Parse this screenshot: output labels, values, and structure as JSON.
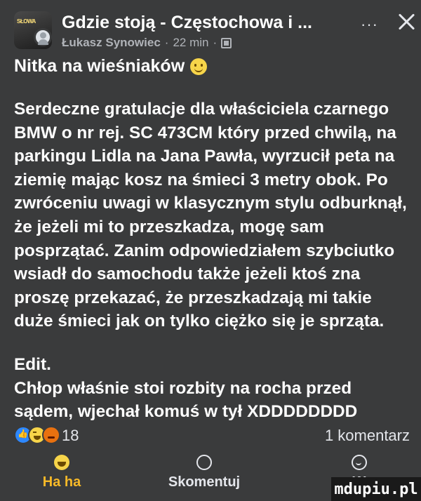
{
  "header": {
    "avatar_text": "SŁOWA",
    "group_name": "Gdzie stoją - Częstochowa i ...",
    "author": "Łukasz Synowiec",
    "time": "22 min",
    "separator": "·",
    "more_label": "···",
    "icons": {
      "more": "more-horizontal-icon",
      "close": "close-icon",
      "audience": "audience-icon"
    }
  },
  "post": {
    "title": "Nitka na wieśniaków",
    "title_emoji": "smile-icon",
    "paragraphs": [
      "Serdeczne gratulacje dla właściciela czarnego BMW o nr rej. SC 473CM który przed chwilą, na parkingu Lidla na Jana Pawła, wyrzucił peta na ziemię mając kosz na śmieci 3 metry obok. Po zwróceniu uwagi w klasycznym stylu odburknął, że jeżeli mi to przeszkadza, mogę sam posprzątać. Zanim odpowiedziałem szybciutko wsiadł do samochodu także jeżeli ktoś zna proszę przekazać, że przeszkadzają mi takie duże śmieci jak on tylko ciężko się je sprząta.",
      "Edit.",
      "Chłop właśnie stoi rozbity na rocha przed sądem, wjechał komuś w tył XDDDDDDDD"
    ]
  },
  "stats": {
    "reaction_icons": [
      "like-icon",
      "haha-icon",
      "angry-icon"
    ],
    "reaction_count": "18",
    "comment_count": "1 komentarz"
  },
  "actions": {
    "reaction_label": "Ha ha",
    "comment_label": "Skomentuj",
    "share_label": "W"
  },
  "watermark": "mdupiu.pl",
  "colors": {
    "background": "#3a3b3c",
    "text": "#ffffff",
    "secondary_text": "#b0b3b8",
    "haha_accent": "#f7b928",
    "like_blue": "#2d88ff"
  }
}
